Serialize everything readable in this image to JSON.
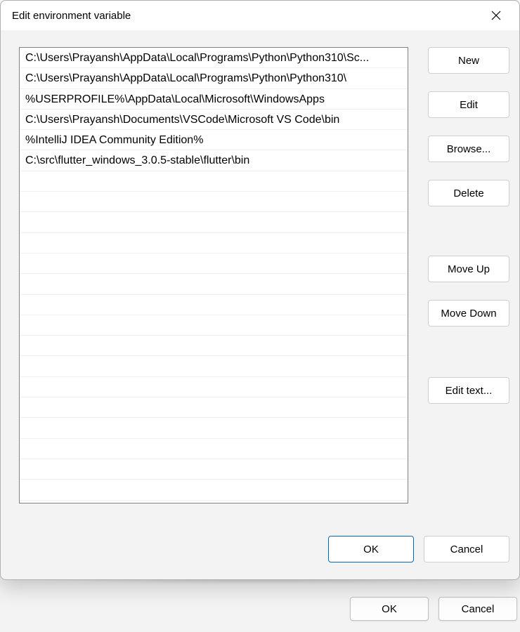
{
  "dialog": {
    "title": "Edit environment variable",
    "listItems": [
      "C:\\Users\\Prayansh\\AppData\\Local\\Programs\\Python\\Python310\\Sc...",
      "C:\\Users\\Prayansh\\AppData\\Local\\Programs\\Python\\Python310\\",
      "%USERPROFILE%\\AppData\\Local\\Microsoft\\WindowsApps",
      "C:\\Users\\Prayansh\\Documents\\VSCode\\Microsoft VS Code\\bin",
      "%IntelliJ IDEA Community Edition%",
      "C:\\src\\flutter_windows_3.0.5-stable\\flutter\\bin"
    ],
    "buttons": {
      "new": "New",
      "edit": "Edit",
      "browse": "Browse...",
      "delete": "Delete",
      "moveUp": "Move Up",
      "moveDown": "Move Down",
      "editText": "Edit text...",
      "ok": "OK",
      "cancel": "Cancel"
    }
  },
  "background": {
    "ok": "OK",
    "cancel": "Cancel"
  }
}
